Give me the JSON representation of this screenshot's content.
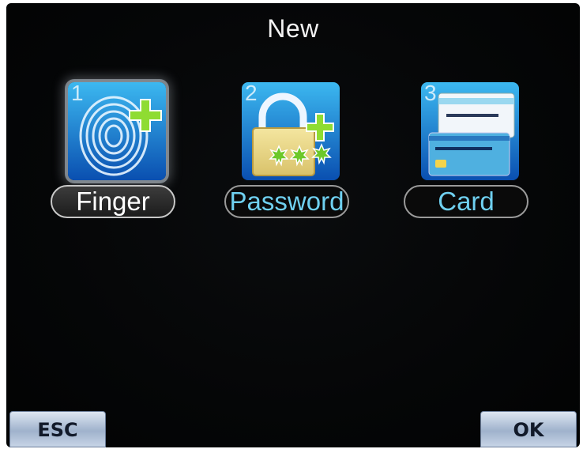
{
  "screen": {
    "title": "New"
  },
  "menu": {
    "items": [
      {
        "number": "1",
        "label": "Finger",
        "icon": "fingerprint-add-icon",
        "selected": true
      },
      {
        "number": "2",
        "label": "Password",
        "icon": "padlock-password-icon",
        "selected": false
      },
      {
        "number": "3",
        "label": "Card",
        "icon": "card-icon",
        "selected": false
      }
    ]
  },
  "softkeys": {
    "left": "ESC",
    "right": "OK"
  },
  "colors": {
    "background": "#050607",
    "label_text": "#6fd0f0",
    "selected_label_text": "#ffffff",
    "icon_blue": "#1a8fd8",
    "plus_green": "#8fdc32"
  }
}
